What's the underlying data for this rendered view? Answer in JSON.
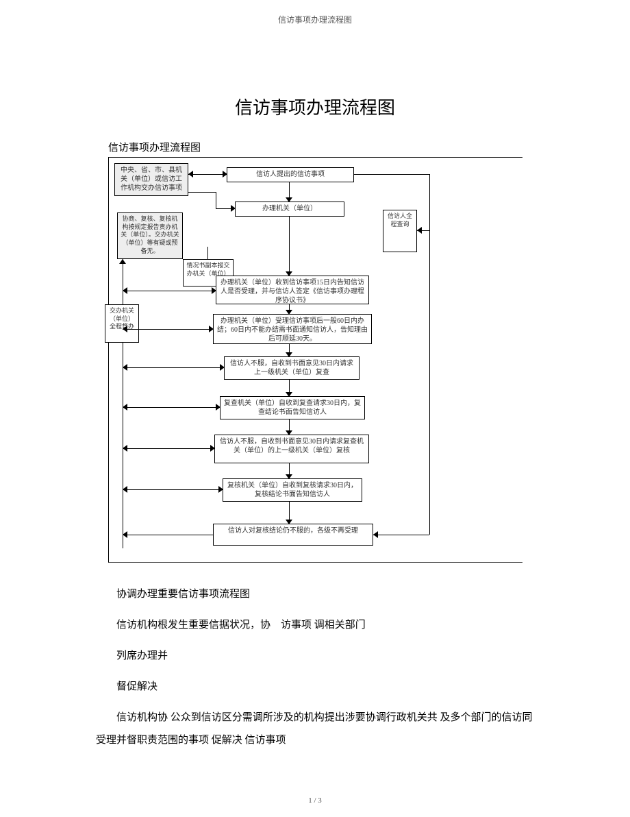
{
  "header": "信访事项办理流程图",
  "title": "信访事项办理流程图",
  "diagram_caption": "信访事项办理流程图",
  "nodes": {
    "n1": "中央、省、市、县机关（单位）或信访工作机构交办信访事项",
    "n2": "信访人提出的信访事项",
    "n3": "办理机关（单位）",
    "n4": "协商、复核、复核机构按规定报告责办机关（单位）。交办机关（单位）等有疑或预备无。",
    "n5": "情况书副本报交办机关（单位）",
    "n6": "办理机关（单位）收到信访事项15日内告知信访人是否受理，并与信访人签定《信访事项办理程序协议书》",
    "n7": "交办机关（单位）全程督办",
    "n8": "办理机关（单位）受理信访事项后一般60日内办结；60日内不能办结需书面通知信访人，告知理由后可顺延30天。",
    "n9": "信访人不服，自收到书面意见30日内请求上一级机关（单位）复查",
    "n10": "复查机关（单位）自收到复查请求30日内，复查结论书面告知信访人",
    "n11": "信访人不服，自收到书面意见30日内请求复查机关（单位）的上一级机关（单位）复核",
    "n12": "复核机关（单位）自收到复核请求30日内，复核结论书面告知信访人",
    "n13": "信访人对复核结论仍不服的，各级不再受理",
    "n14": "信访人全程查询"
  },
  "body": {
    "sect_title": "协调办理重要信访事项流程图",
    "p1": "信访机构根发生重要信据状况，协　访事项 调相关部门",
    "p2": "列席办理并",
    "p3": "督促解决",
    "p4": "信访机构协 公众到信访区分需调所涉及的机构提出涉要协调行政机关共 及多个部门的信访同受理并督职责范围的事项 促解决 信访事项"
  },
  "page_number": "1 / 3"
}
